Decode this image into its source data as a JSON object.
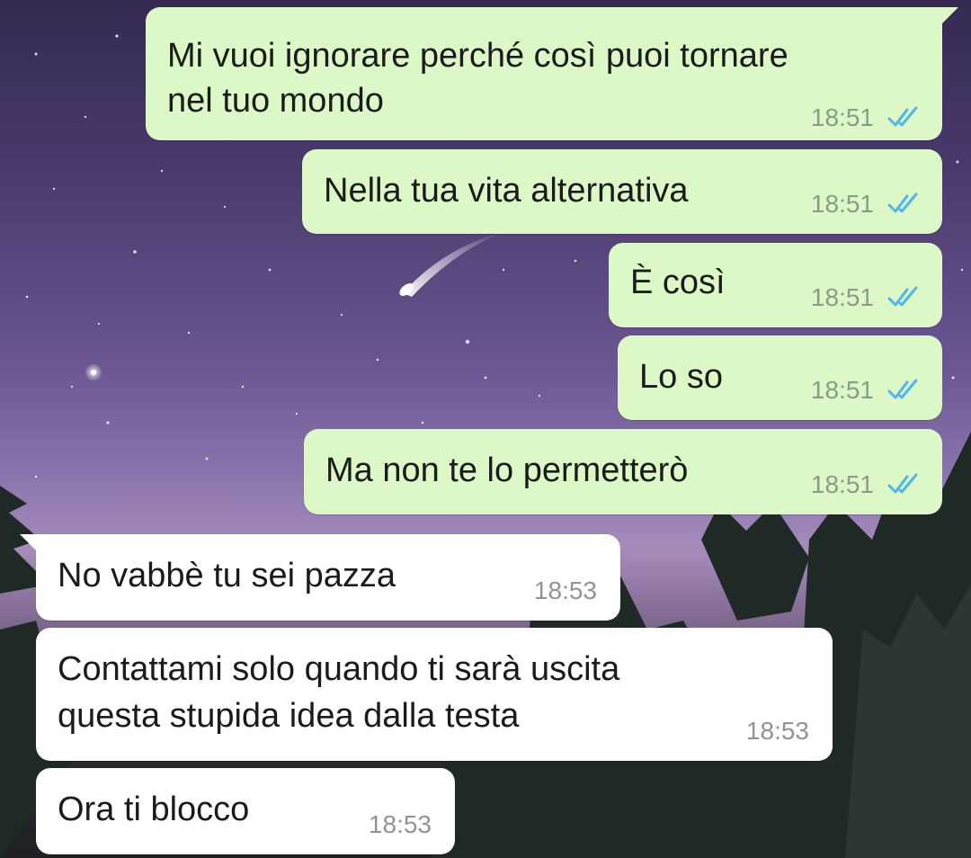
{
  "colors": {
    "outgoing_bubble": "#dcf8c6",
    "incoming_bubble": "#ffffff",
    "read_ticks": "#4fb6ec",
    "timestamp": "#8c9a8c"
  },
  "messages": [
    {
      "direction": "outgoing",
      "lines": [
        "Mi vuoi ignorare perché così puoi tornare",
        "nel tuo mondo"
      ],
      "time": "18:51",
      "status_icon": "double-check-read-icon"
    },
    {
      "direction": "outgoing",
      "lines": [
        "Nella tua vita alternativa"
      ],
      "time": "18:51",
      "status_icon": "double-check-read-icon"
    },
    {
      "direction": "outgoing",
      "lines": [
        "È così"
      ],
      "time": "18:51",
      "status_icon": "double-check-read-icon"
    },
    {
      "direction": "outgoing",
      "lines": [
        "Lo so"
      ],
      "time": "18:51",
      "status_icon": "double-check-read-icon"
    },
    {
      "direction": "outgoing",
      "lines": [
        "Ma non te lo permetterò"
      ],
      "time": "18:51",
      "status_icon": "double-check-read-icon"
    },
    {
      "direction": "incoming",
      "lines": [
        "No vabbè tu sei pazza"
      ],
      "time": "18:53"
    },
    {
      "direction": "incoming",
      "lines": [
        "Contattami solo quando ti sarà uscita",
        "questa stupida idea dalla testa"
      ],
      "time": "18:53"
    },
    {
      "direction": "incoming",
      "lines": [
        "Ora ti blocco"
      ],
      "time": "18:53"
    }
  ]
}
